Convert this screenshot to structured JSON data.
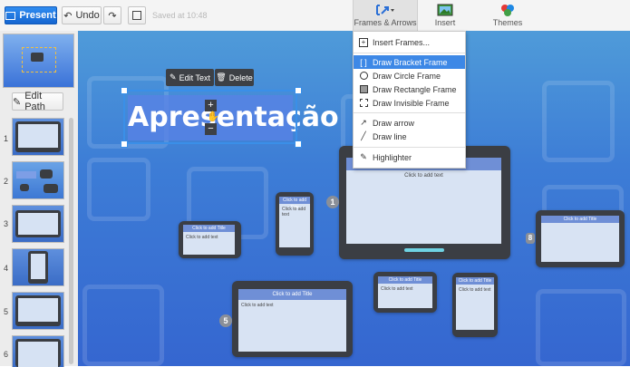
{
  "toolbar": {
    "present_label": "Present",
    "undo_label": "Undo",
    "saved_text": "Saved at 10:48",
    "frames_label": "Frames & Arrows",
    "insert_label": "Insert",
    "themes_label": "Themes"
  },
  "sidebar": {
    "edit_path_label": "Edit Path",
    "thumbnails": [
      {
        "number": "1"
      },
      {
        "number": "2"
      },
      {
        "number": "3"
      },
      {
        "number": "4"
      },
      {
        "number": "5"
      },
      {
        "number": "6"
      }
    ]
  },
  "context_menu": {
    "edit_text_label": "Edit Text",
    "delete_label": "Delete"
  },
  "canvas": {
    "title_text": "Apresentação",
    "zoom_in": "+",
    "zoom_out": "−",
    "click_title": "Click to add Title",
    "click_text": "Click to add text",
    "step_1": "1",
    "step_5": "5",
    "step_8": "8"
  },
  "frames_menu": {
    "items": [
      {
        "label": "Insert Frames...",
        "icon": "insert-frames-icon"
      },
      {
        "label": "Draw Bracket Frame",
        "icon": "bracket-frame-icon",
        "active": true
      },
      {
        "label": "Draw Circle Frame",
        "icon": "circle-frame-icon"
      },
      {
        "label": "Draw Rectangle Frame",
        "icon": "rectangle-frame-icon"
      },
      {
        "label": "Draw Invisible Frame",
        "icon": "invisible-frame-icon"
      },
      {
        "label": "Draw arrow",
        "icon": "arrow-icon"
      },
      {
        "label": "Draw line",
        "icon": "line-icon"
      },
      {
        "label": "Highlighter",
        "icon": "highlighter-icon"
      }
    ]
  },
  "colors": {
    "accent": "#3d88e6",
    "present_button": "#1f76e0",
    "selection": "#3a8fe8"
  }
}
